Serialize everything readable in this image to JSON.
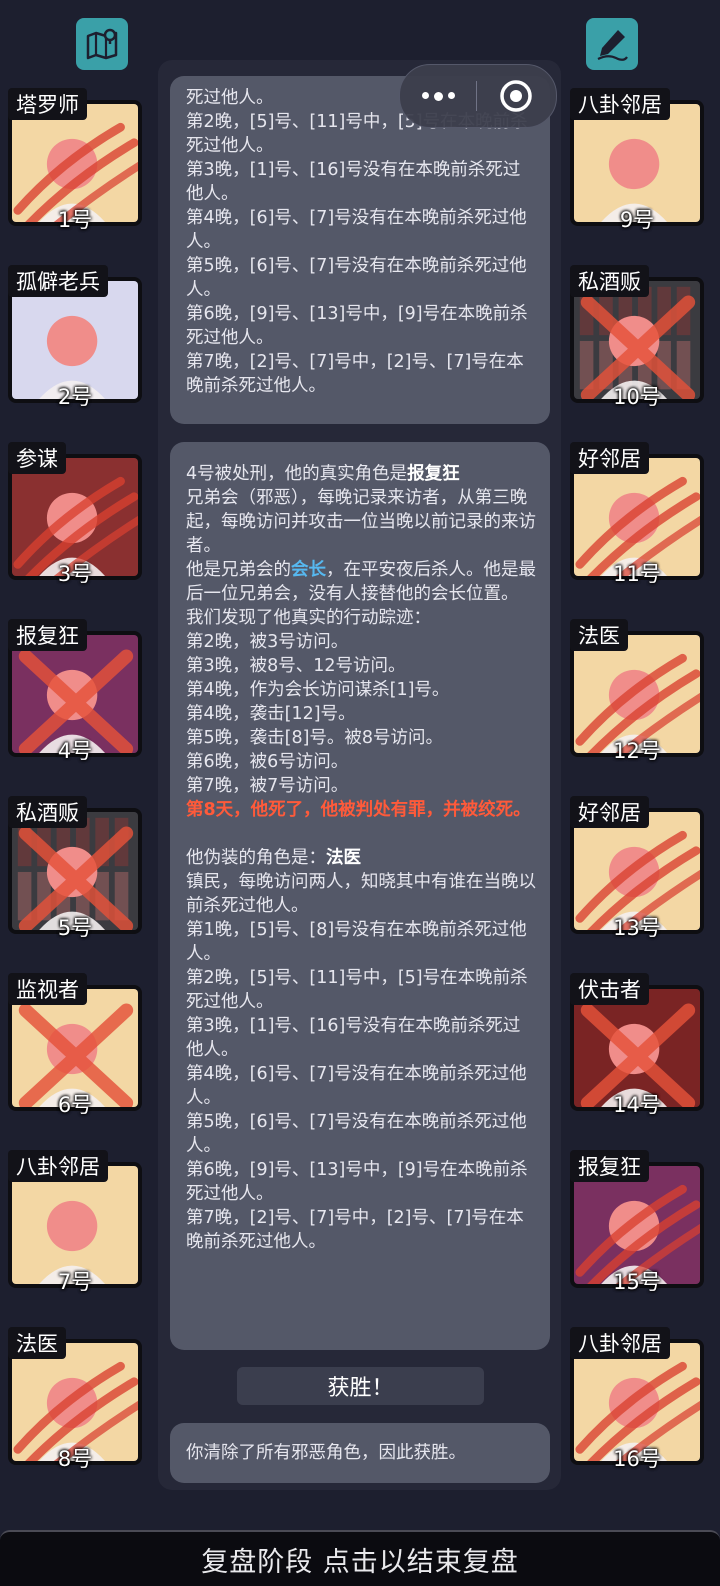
{
  "top_icons": {
    "left": "map-pin-icon",
    "right": "pen-write-icon"
  },
  "capsule": {
    "more": "more-dots-icon",
    "close": "target-close-icon"
  },
  "colors": {
    "background": "#1d1f2f",
    "panel": "#262838",
    "log_box": "#545868",
    "accent_blue": "#56b8f0",
    "accent_red": "#ff5a3a",
    "icon_teal": "#3aa0a8"
  },
  "players_left": [
    {
      "role": "塔罗师",
      "number": "1号",
      "status": "dead-scratch",
      "bg": "#f3d7a4"
    },
    {
      "role": "孤僻老兵",
      "number": "2号",
      "status": "alive",
      "bg": "#d8d8ee"
    },
    {
      "role": "参谋",
      "number": "3号",
      "status": "dead-scratch",
      "bg": "#8a3030"
    },
    {
      "role": "报复狂",
      "number": "4号",
      "status": "executed-x",
      "bg": "#7a3060"
    },
    {
      "role": "私酒贩",
      "number": "5号",
      "status": "executed-x",
      "bg": "#3b3b40"
    },
    {
      "role": "监视者",
      "number": "6号",
      "status": "executed-x",
      "bg": "#f3d7a4"
    },
    {
      "role": "八卦邻居",
      "number": "7号",
      "status": "alive",
      "bg": "#f3d7a4"
    },
    {
      "role": "法医",
      "number": "8号",
      "status": "dead-scratch",
      "bg": "#f3d7a4"
    }
  ],
  "players_right": [
    {
      "role": "八卦邻居",
      "number": "9号",
      "status": "alive",
      "bg": "#f3d7a4"
    },
    {
      "role": "私酒贩",
      "number": "10号",
      "status": "executed-x",
      "bg": "#3b3b40"
    },
    {
      "role": "好邻居",
      "number": "11号",
      "status": "dead-scratch",
      "bg": "#f3d7a4"
    },
    {
      "role": "法医",
      "number": "12号",
      "status": "dead-scratch",
      "bg": "#f3d7a4"
    },
    {
      "role": "好邻居",
      "number": "13号",
      "status": "dead-scratch",
      "bg": "#f3d7a4"
    },
    {
      "role": "伏击者",
      "number": "14号",
      "status": "executed-x",
      "bg": "#7a2424"
    },
    {
      "role": "报复狂",
      "number": "15号",
      "status": "dead-scratch",
      "bg": "#7a3060"
    },
    {
      "role": "八卦邻居",
      "number": "16号",
      "status": "dead-scratch",
      "bg": "#f3d7a4"
    }
  ],
  "log_top": [
    "死过他人。",
    "第2晚，[5]号、[11]号中，[5]号在本晚前杀死过他人。",
    "第3晚，[1]号、[16]号没有在本晚前杀死过他人。",
    "第4晚，[6]号、[7]号没有在本晚前杀死过他人。",
    "第5晚，[6]号、[7]号没有在本晚前杀死过他人。",
    "第6晚，[9]号、[13]号中，[9]号在本晚前杀死过他人。",
    "第7晚，[2]号、[7]号中，[2]号、[7]号在本晚前杀死过他人。"
  ],
  "log_main": {
    "intro_prefix": "4号被处刑，他的真实角色是",
    "intro_role": "报复狂",
    "role_desc": "兄弟会（邪恶），每晚记录来访者，从第三晚起，每晚访问并攻击一位当晚以前记录的来访者。",
    "leader_prefix": "他是兄弟会的",
    "leader_word": "会长",
    "leader_suffix": "，在平安夜后杀人。他是最后一位兄弟会，没有人接替他的会长位置。",
    "trace_title": "我们发现了他真实的行动踪迹：",
    "trace": [
      "第2晚，被3号访问。",
      "第3晚，被8号、12号访问。",
      "第4晚，作为会长访问谋杀[1]号。",
      "第4晚，袭击[12]号。",
      "第5晚，袭击[8]号。被8号访问。",
      "第6晚，被6号访问。",
      "第7晚，被7号访问。"
    ],
    "death": "第8天，他死了，他被判处有罪，并被绞死。",
    "disguise_prefix": "他伪装的角色是：",
    "disguise_role": "法医",
    "disguise_desc": "镇民，每晚访问两人，知晓其中有谁在当晚以前杀死过他人。",
    "disguise_nights": [
      "第1晚，[5]号、[8]号没有在本晚前杀死过他人。",
      "第2晚，[5]号、[11]号中，[5]号在本晚前杀死过他人。",
      "第3晚，[1]号、[16]号没有在本晚前杀死过他人。",
      "第4晚，[6]号、[7]号没有在本晚前杀死过他人。",
      "第5晚，[6]号、[7]号没有在本晚前杀死过他人。",
      "第6晚，[9]号、[13]号中，[9]号在本晚前杀死过他人。",
      "第7晚，[2]号、[7]号中，[2]号、[7]号在本晚前杀死过他人。"
    ]
  },
  "victory": {
    "button": "获胜！",
    "message": "你清除了所有邪恶角色，因此获胜。"
  },
  "footer": {
    "label": "复盘阶段 点击以结束复盘"
  }
}
